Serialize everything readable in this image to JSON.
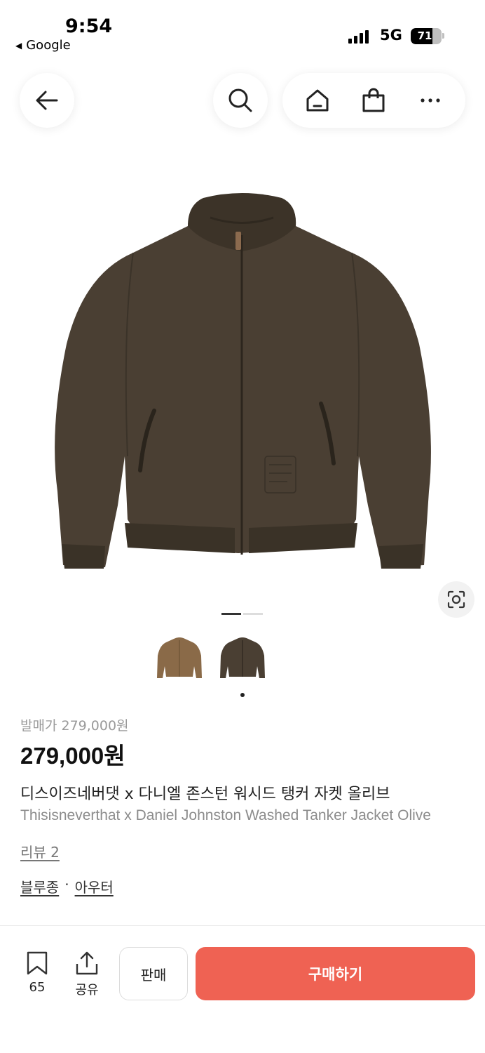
{
  "status_bar": {
    "time": "9:54",
    "back_app": "Google",
    "network": "5G",
    "battery": "71",
    "battery_level": 0.71
  },
  "nav": {
    "icons": [
      "arrow-left-icon",
      "search-icon",
      "home-icon",
      "shopping-bag-icon",
      "more-icon"
    ]
  },
  "gallery": {
    "page_count": 2,
    "current_page": 1,
    "thumbnails": [
      "jacket-olive-light",
      "jacket-olive-dark"
    ],
    "selected_thumbnail": 1
  },
  "product": {
    "release_price": "발매가 279,000원",
    "price": "279,000원",
    "name_ko": "디스이즈네버댓 x 다니엘 존스턴 워시드 탱커 자켓 올리브",
    "name_en": "Thisisneverthat x Daniel Johnston Washed Tanker Jacket Olive",
    "review": "리뷰 2",
    "category_1": "블루종",
    "separator": "·",
    "category_2": "아우터"
  },
  "bottom_bar": {
    "save_count": "65",
    "share_label": "공유",
    "sell_label": "판매",
    "buy_label": "구매하기"
  },
  "colors": {
    "buy_button": "#ef6253",
    "jacket_dark": "#4a3f33",
    "jacket_light": "#8a6a48"
  }
}
